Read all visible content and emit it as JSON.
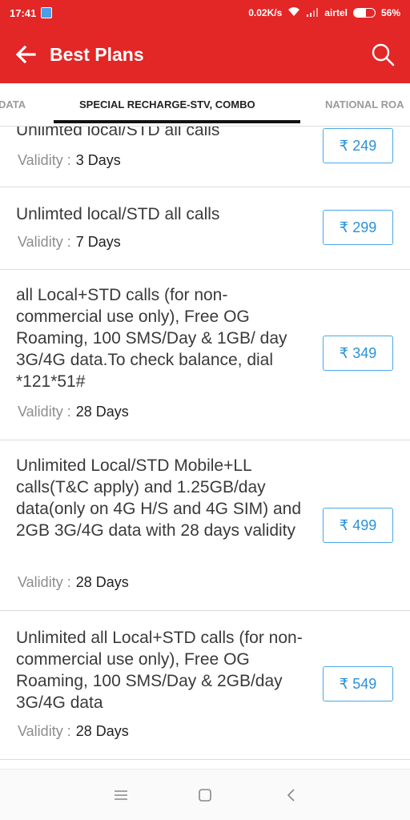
{
  "status": {
    "time": "17:41",
    "net_speed": "0.02K/s",
    "carrier": "airtel",
    "battery": "56%",
    "battery_level": 0.56
  },
  "app_bar": {
    "title": "Best Plans",
    "back_icon": "arrow-back-icon",
    "search_icon": "search-icon"
  },
  "tabs": {
    "left": "DATA",
    "active": "SPECIAL RECHARGE-STV, COMBO",
    "right": "NATIONAL ROA"
  },
  "validity_label": "Validity :",
  "plans": [
    {
      "description": "Unlimted local/STD all calls",
      "validity": "3 Days",
      "price": "₹ 249"
    },
    {
      "description": "Unlimted local/STD all calls",
      "validity": "7 Days",
      "price": "₹ 299"
    },
    {
      "description": "all Local+STD calls (for non-commercial use only), Free OG Roaming, 100 SMS/Day & 1GB/ day 3G/4G data.To check balance, dial *121*51#",
      "validity": "28 Days",
      "price": "₹ 349"
    },
    {
      "description": "Unlimited Local/STD Mobile+LL calls(T&C apply) and 1.25GB/day data(only on 4G H/S and 4G SIM) and 2GB 3G/4G data with 28 days validity",
      "validity": "28 Days",
      "price": "₹ 499"
    },
    {
      "description": "Unlimited all Local+STD calls (for non-commercial use only), Free OG Roaming, 100 SMS/Day & 2GB/day 3G/4G data",
      "validity": "28 Days",
      "price": "₹ 549"
    }
  ],
  "nav": {
    "menu_icon": "menu-icon",
    "home_icon": "home-square-icon",
    "back_icon": "nav-back-icon"
  },
  "colors": {
    "primary": "#e32626",
    "price_border": "#4aa8e8",
    "price_text": "#2a92da"
  }
}
